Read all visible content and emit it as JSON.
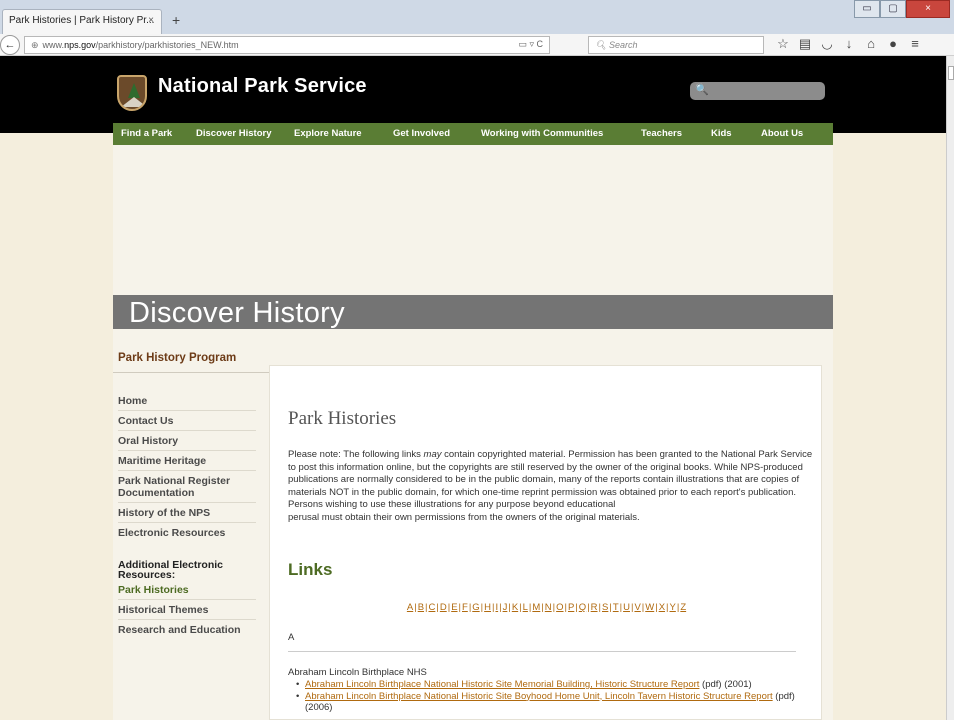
{
  "browser": {
    "tab_title": "Park Histories | Park History Pr...",
    "tab_close": "×",
    "new_tab": "+",
    "window_buttons": [
      "▭",
      "▢",
      "×"
    ],
    "back": "←",
    "url_prefix": "www.",
    "url_domain": "nps.gov",
    "url_path": "/parkhistory/parkhistories_NEW.htm",
    "url_icons": "▭ ▿  C",
    "search_placeholder": "Search",
    "toolbar_icons": [
      "star-icon",
      "bookmark-icon",
      "pocket-icon",
      "download-icon",
      "home-icon",
      "chat-icon",
      "menu-icon"
    ]
  },
  "site": {
    "title": "National Park Service",
    "search_icon": "🔍"
  },
  "nav": [
    "Find a Park",
    "Discover History",
    "Explore Nature",
    "Get Involved",
    "Working with Communities",
    "Teachers",
    "Kids",
    "About Us"
  ],
  "banner": {
    "title": "Discover History"
  },
  "sidebar": {
    "heading": "Park History Program",
    "items": [
      "Home",
      "Contact Us",
      "Oral History",
      "Maritime Heritage",
      "Park National Register Documentation",
      "History of the NPS",
      "Electronic Resources"
    ],
    "subhead": "Additional Electronic Resources:",
    "sub_items": [
      "Park Histories",
      "Historical Themes",
      "Research and Education"
    ]
  },
  "main": {
    "title": "Park Histories",
    "notice_1": "Please note: The following links ",
    "notice_em": "may",
    "notice_2": " contain copyrighted material. Permission has been granted to the National Park Service to post this information online, but the copyrights are still reserved by the owner of the original books. While NPS-produced publications are normally considered to be in the public domain, many of the reports contain illustrations that are copies of materials NOT in the public domain, for which one-time reprint permission was obtained prior to each report's publication. Persons wishing to use these illustrations for any purpose beyond educational",
    "notice_3": "perusal must obtain their own permissions from the owners of the original materials.",
    "links_heading": "Links",
    "alphabet": [
      "A",
      "B",
      "C",
      "D",
      "E",
      "F",
      "G",
      "H",
      "I",
      "J",
      "K",
      "L",
      "M",
      "N",
      "O",
      "P",
      "Q",
      "R",
      "S",
      "T",
      "U",
      "V",
      "W",
      "X",
      "Y",
      "Z"
    ],
    "section_letter": "A",
    "entry_title": "Abraham Lincoln Birthplace NHS",
    "entries": [
      {
        "link": "Abraham Lincoln Birthplace National Historic Site Memorial Building, Historic Structure Report",
        "suffix": " (pdf) (2001)"
      },
      {
        "link": "Abraham Lincoln Birthplace National Historic Site Boyhood Home Unit, Lincoln Tavern Historic Structure Report",
        "suffix": " (pdf) (2006)"
      }
    ]
  }
}
